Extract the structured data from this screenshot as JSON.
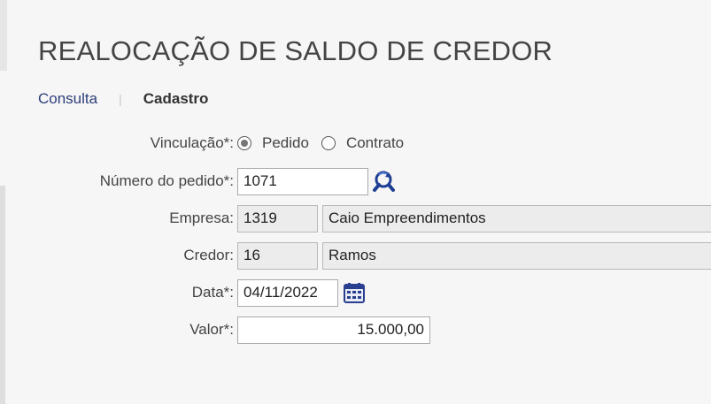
{
  "page": {
    "title": "REALOCAÇÃO DE SALDO DE CREDOR"
  },
  "tabs": {
    "consulta": "Consulta",
    "separator": "|",
    "cadastro": "Cadastro"
  },
  "form": {
    "vinculacao": {
      "label": "Vinculação*:",
      "options": [
        "Pedido",
        "Contrato"
      ],
      "selected": "Pedido"
    },
    "numero_pedido": {
      "label": "Número do pedido*:",
      "value": "1071",
      "search_icon": "search-refresh-icon"
    },
    "empresa": {
      "label": "Empresa:",
      "code": "1319",
      "name": "Caio Empreendimentos"
    },
    "credor": {
      "label": "Credor:",
      "code": "16",
      "name": "Ramos"
    },
    "data": {
      "label": "Data*:",
      "value": "04/11/2022",
      "calendar_icon": "calendar-icon"
    },
    "valor": {
      "label": "Valor*:",
      "value": "15.000,00"
    }
  },
  "colors": {
    "accent": "#2c3e7a",
    "background": "#f6f6f6"
  }
}
